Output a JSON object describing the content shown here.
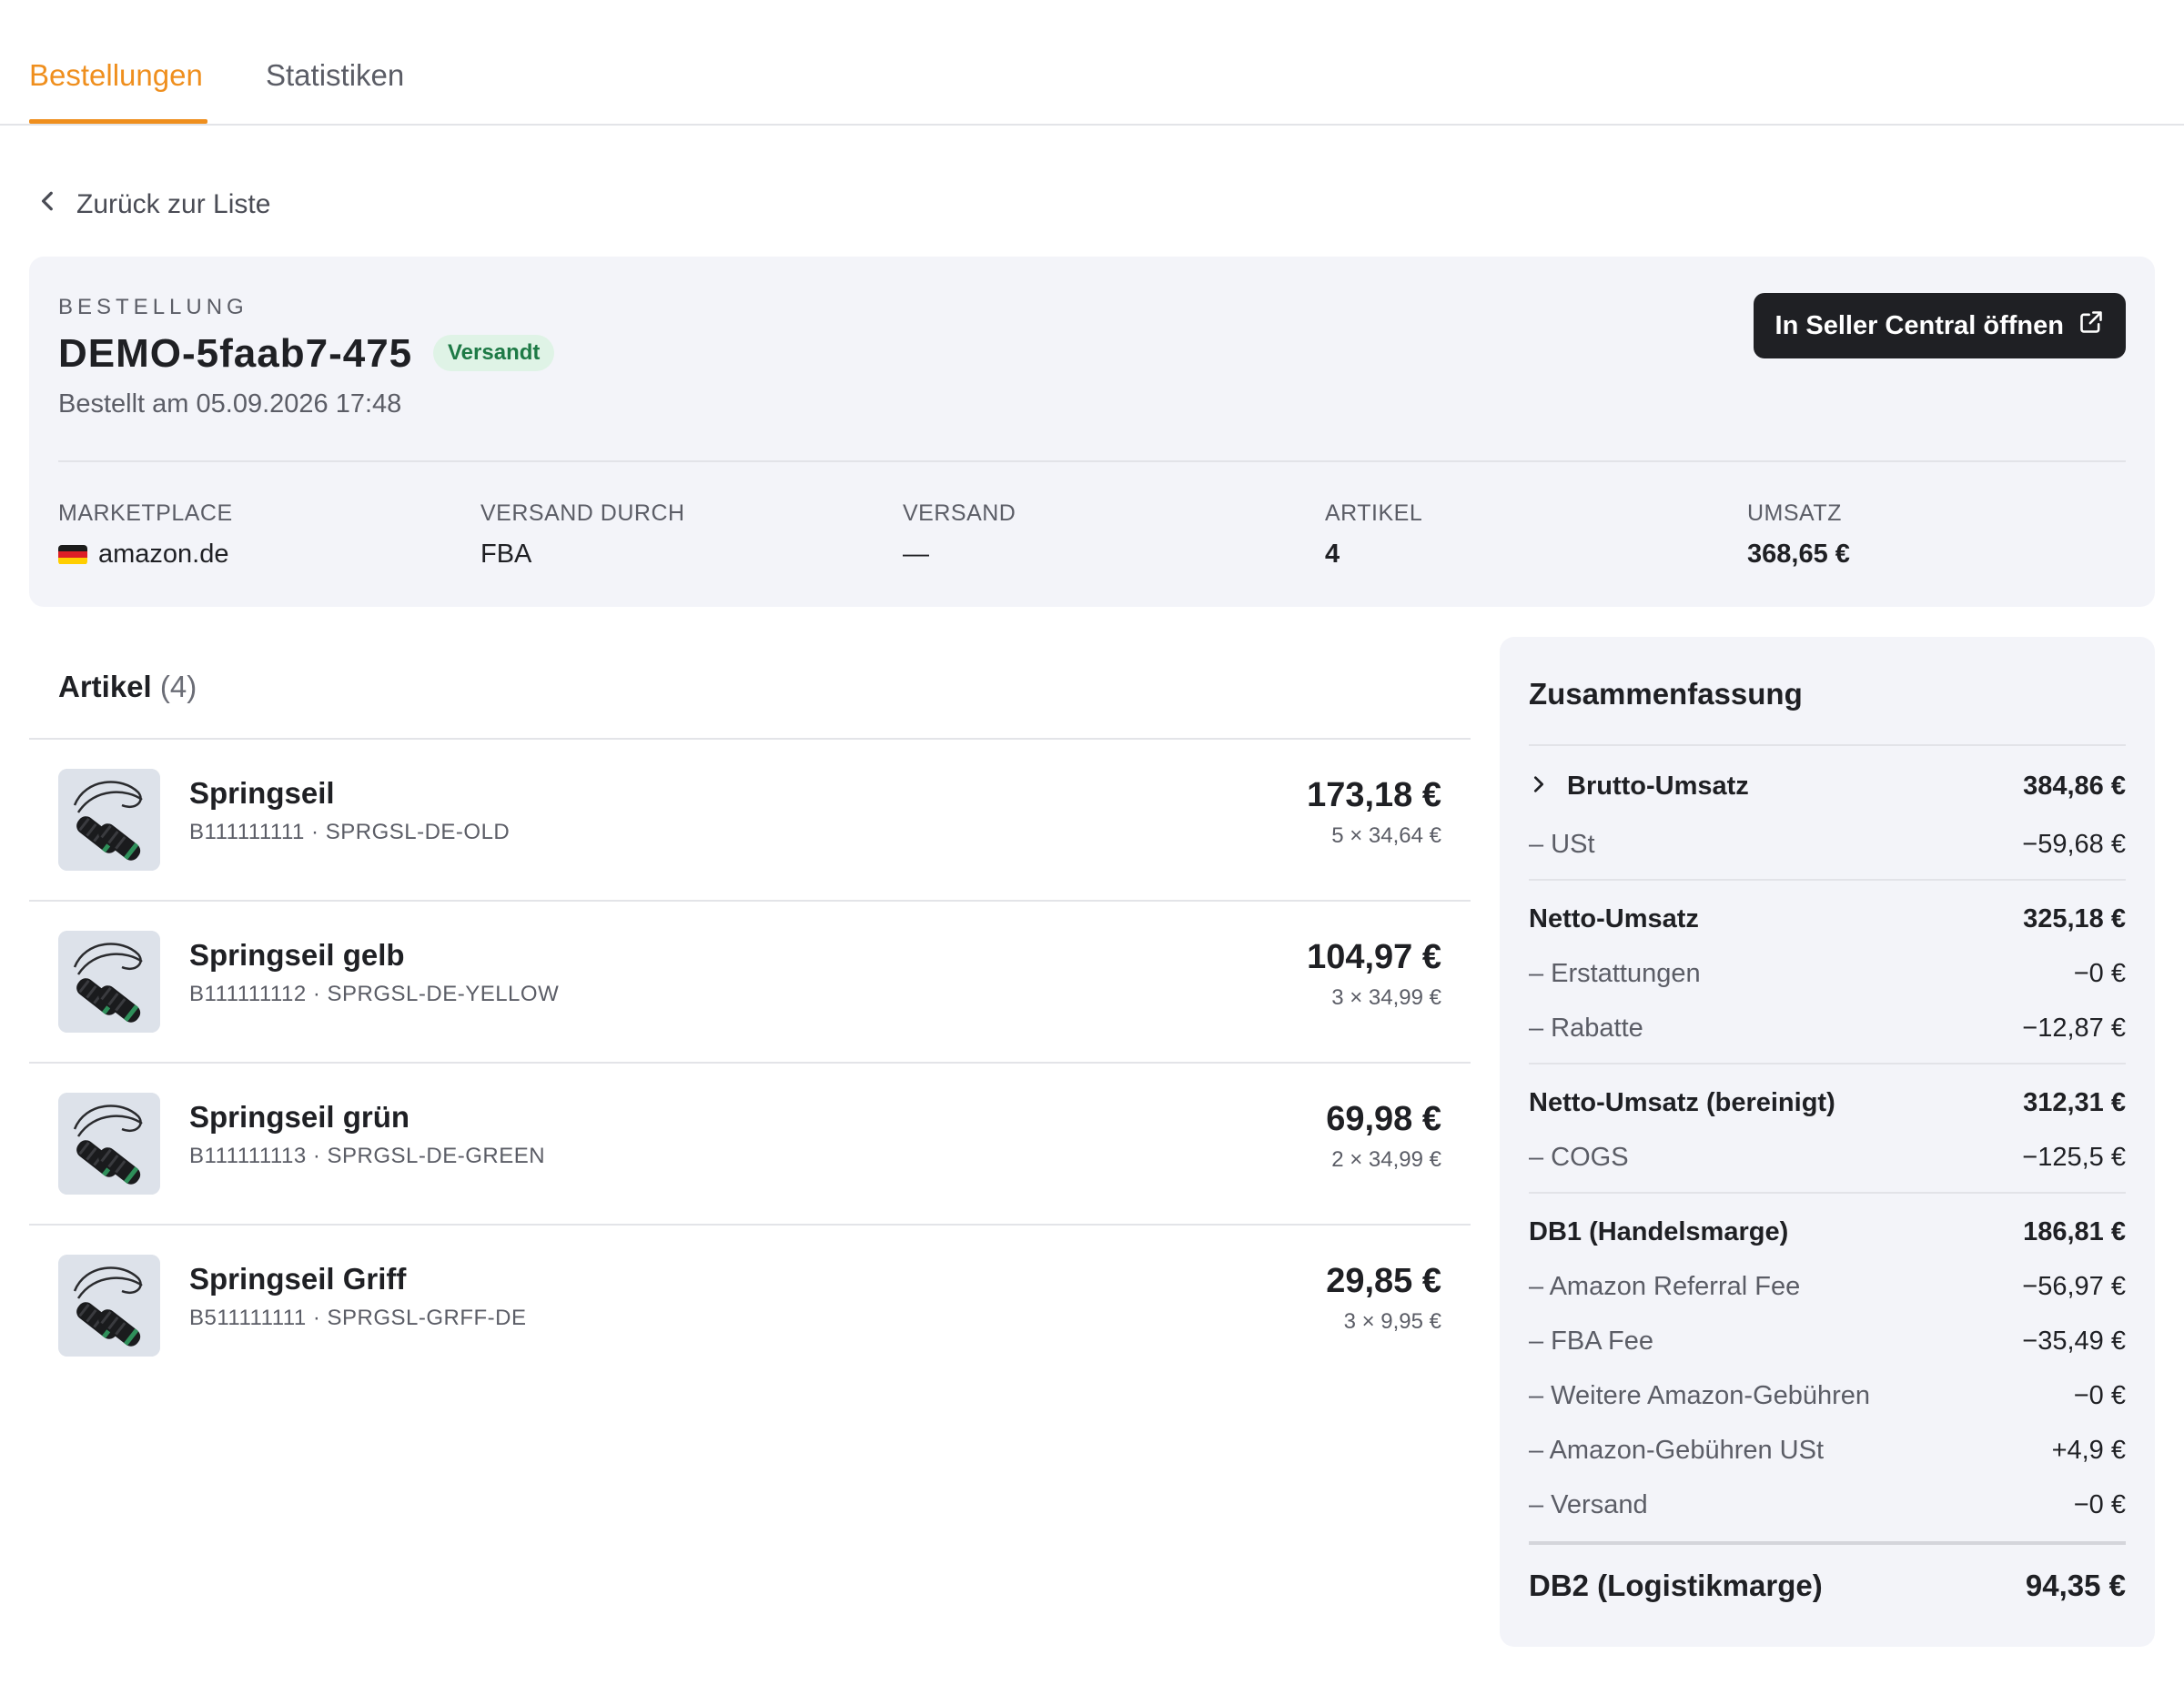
{
  "tabs": [
    {
      "label": "Bestellungen",
      "active": true
    },
    {
      "label": "Statistiken",
      "active": false
    }
  ],
  "back_link": "Zurück zur Liste",
  "order": {
    "eyebrow": "BESTELLUNG",
    "id": "DEMO-5faab7-475",
    "status": "Versandt",
    "date": "Bestellt am 05.09.2026 17:48",
    "seller_button": "In Seller Central öffnen",
    "meta": {
      "marketplace_label": "MARKETPLACE",
      "marketplace_value": "amazon.de",
      "versand_durch_label": "VERSAND DURCH",
      "versand_durch_value": "FBA",
      "versand_label": "VERSAND",
      "versand_value": "—",
      "artikel_label": "ARTIKEL",
      "artikel_value": "4",
      "umsatz_label": "UMSATZ",
      "umsatz_value": "368,65 €"
    }
  },
  "items_section": {
    "title": "Artikel",
    "count": "(4)",
    "items": [
      {
        "name": "Springseil",
        "sku": "B111111111 · SPRGSL-DE-OLD",
        "total": "173,18 €",
        "qty": "5 × 34,64 €"
      },
      {
        "name": "Springseil gelb",
        "sku": "B111111112 · SPRGSL-DE-YELLOW",
        "total": "104,97 €",
        "qty": "3 × 34,99 €"
      },
      {
        "name": "Springseil grün",
        "sku": "B111111113 · SPRGSL-DE-GREEN",
        "total": "69,98 €",
        "qty": "2 × 34,99 €"
      },
      {
        "name": "Springseil Griff",
        "sku": "B511111111 · SPRGSL-GRFF-DE",
        "total": "29,85 €",
        "qty": "3 × 9,95 €"
      }
    ]
  },
  "summary": {
    "title": "Zusammenfassung",
    "rows": [
      {
        "label": "Brutto-Umsatz",
        "value": "384,86 €"
      },
      {
        "label": "– USt",
        "value": "−59,68 €"
      },
      {
        "label": "Netto-Umsatz",
        "value": "325,18 €"
      },
      {
        "label": "– Erstattungen",
        "value": "−0 €"
      },
      {
        "label": "– Rabatte",
        "value": "−12,87 €"
      },
      {
        "label": "Netto-Umsatz (bereinigt)",
        "value": "312,31 €"
      },
      {
        "label": "– COGS",
        "value": "−125,5 €"
      },
      {
        "label": "DB1 (Handelsmarge)",
        "value": "186,81 €"
      },
      {
        "label": "– Amazon Referral Fee",
        "value": "−56,97 €"
      },
      {
        "label": "– FBA Fee",
        "value": "−35,49 €"
      },
      {
        "label": "– Weitere Amazon-Gebühren",
        "value": "−0 €"
      },
      {
        "label": "– Amazon-Gebühren USt",
        "value": "+4,9 €"
      },
      {
        "label": "– Versand",
        "value": "−0 €"
      },
      {
        "label": "DB2 (Logistikmarge)",
        "value": "94,35 €"
      }
    ]
  },
  "colors": {
    "accent": "#ef8f1e",
    "card_bg": "#f3f4f9",
    "badge_bg": "#dff3e6",
    "badge_text": "#1e7a46",
    "button_bg": "#1f2024"
  },
  "icons": {
    "back": "chevron-left-icon",
    "external": "external-link-icon",
    "expand": "chevron-right-icon",
    "flag": "germany-flag-icon"
  }
}
